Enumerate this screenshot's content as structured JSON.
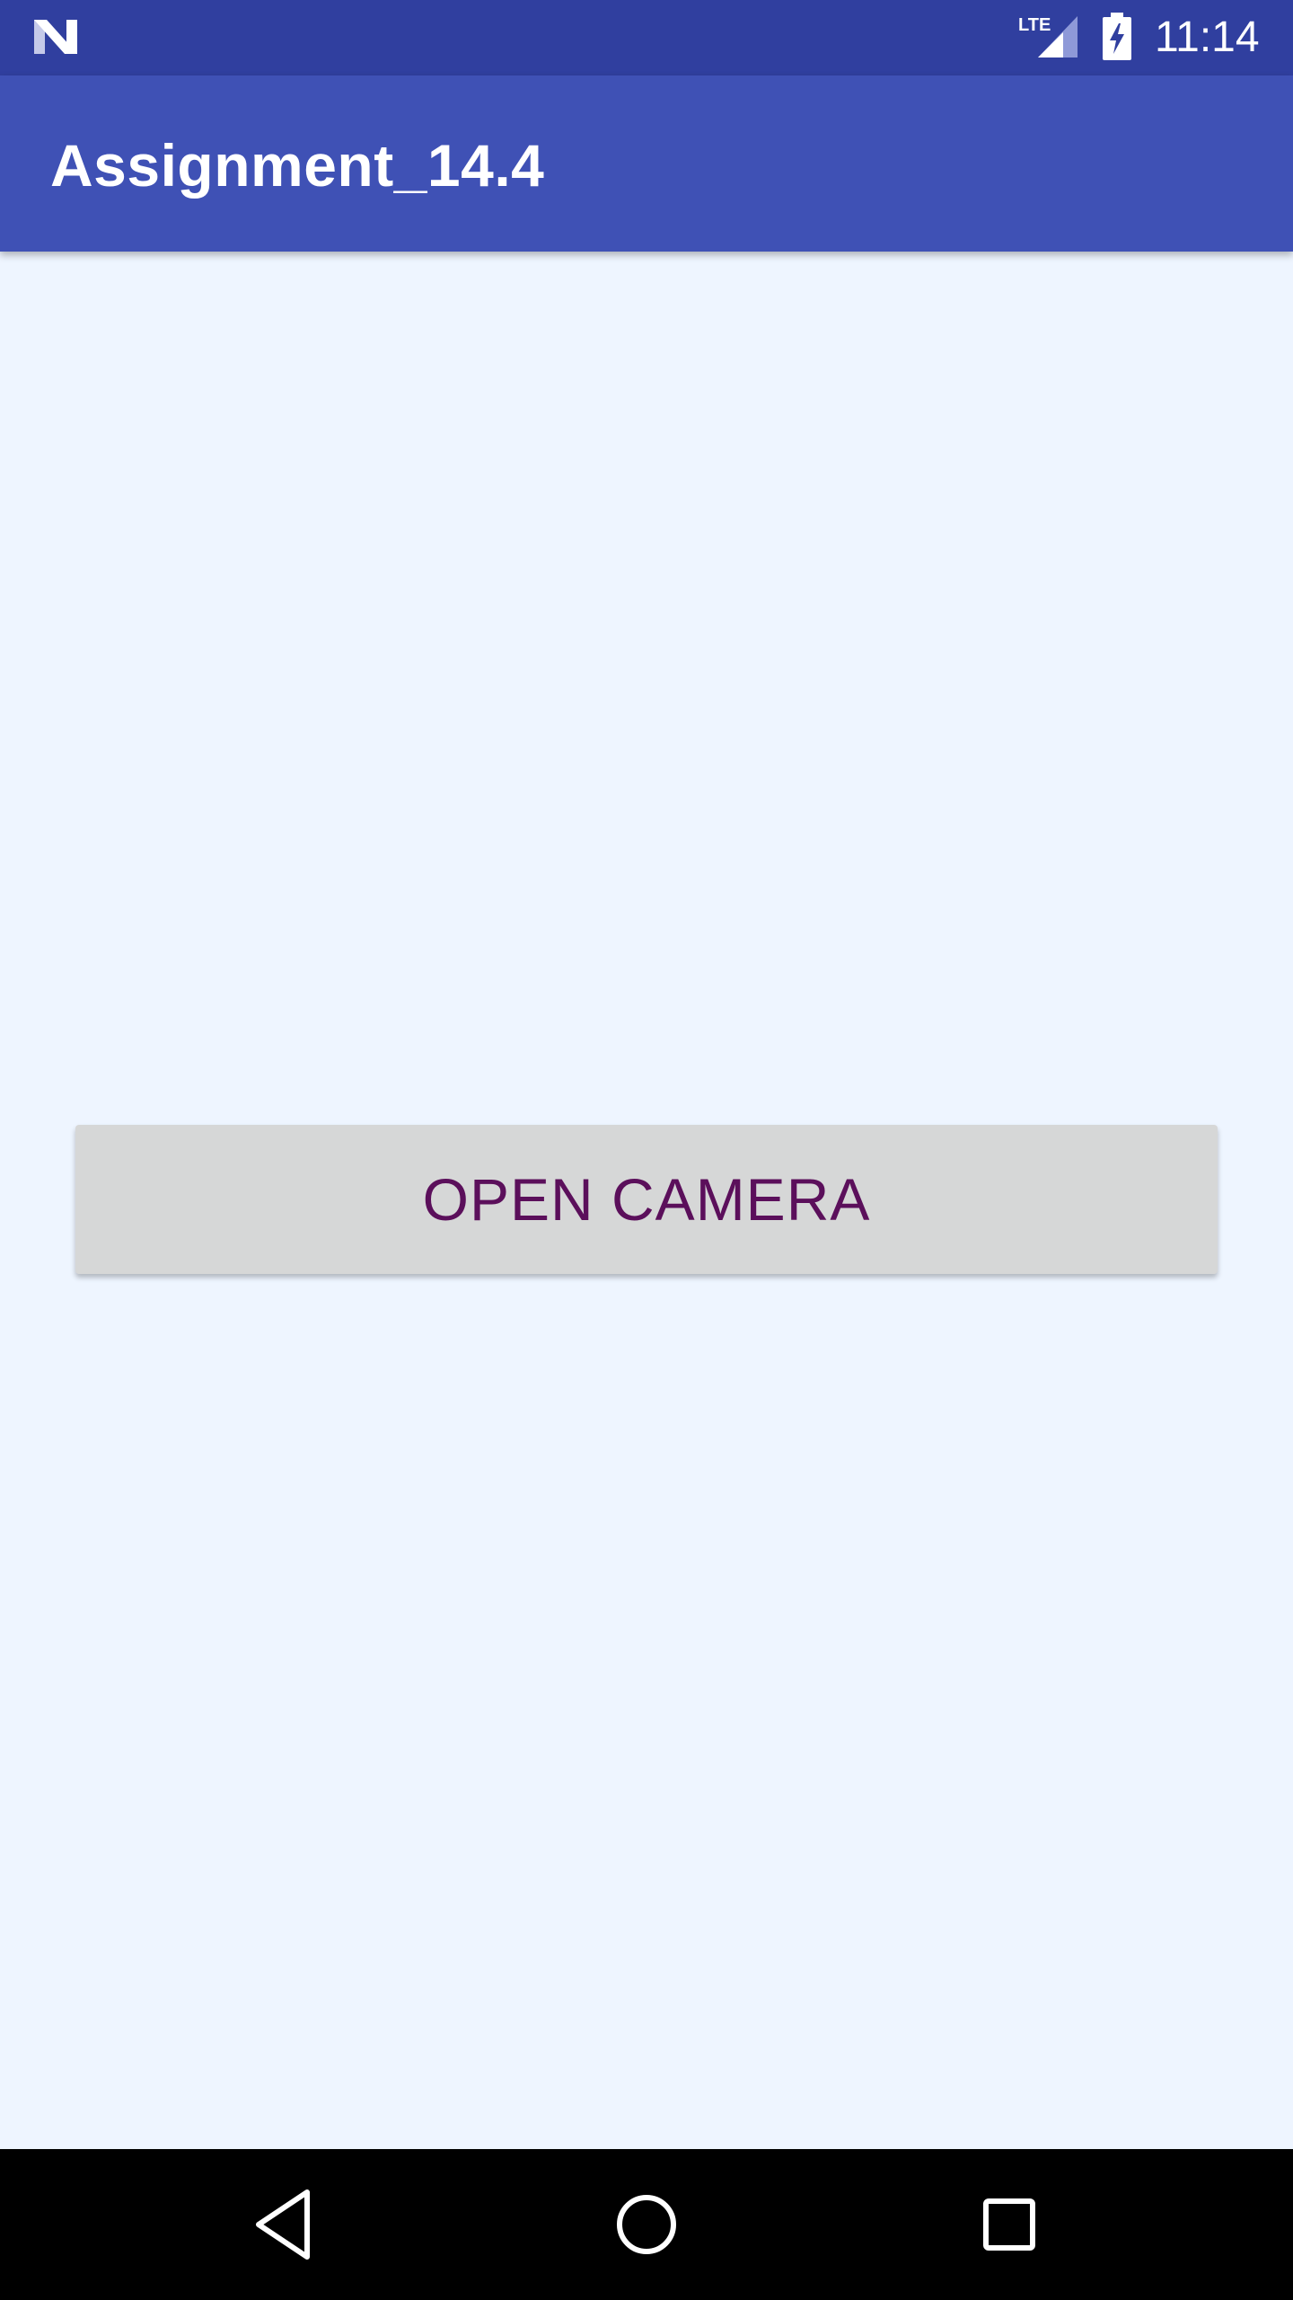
{
  "status_bar": {
    "time": "11:14",
    "network": "LTE",
    "notification_icon": "android-n-icon",
    "signal_icon": "lte-signal-icon",
    "battery_icon": "battery-charging-icon"
  },
  "app_bar": {
    "title": "Assignment_14.4"
  },
  "main": {
    "open_camera_label": "OPEN CAMERA"
  },
  "nav_bar": {
    "back_icon": "back-triangle-icon",
    "home_icon": "home-circle-icon",
    "recents_icon": "recents-square-icon"
  },
  "colors": {
    "status_bar": "#303f9f",
    "app_bar": "#3f51b5",
    "background": "#eef5ff",
    "button_bg": "#d6d7d7",
    "button_text": "#5b0f5b"
  }
}
